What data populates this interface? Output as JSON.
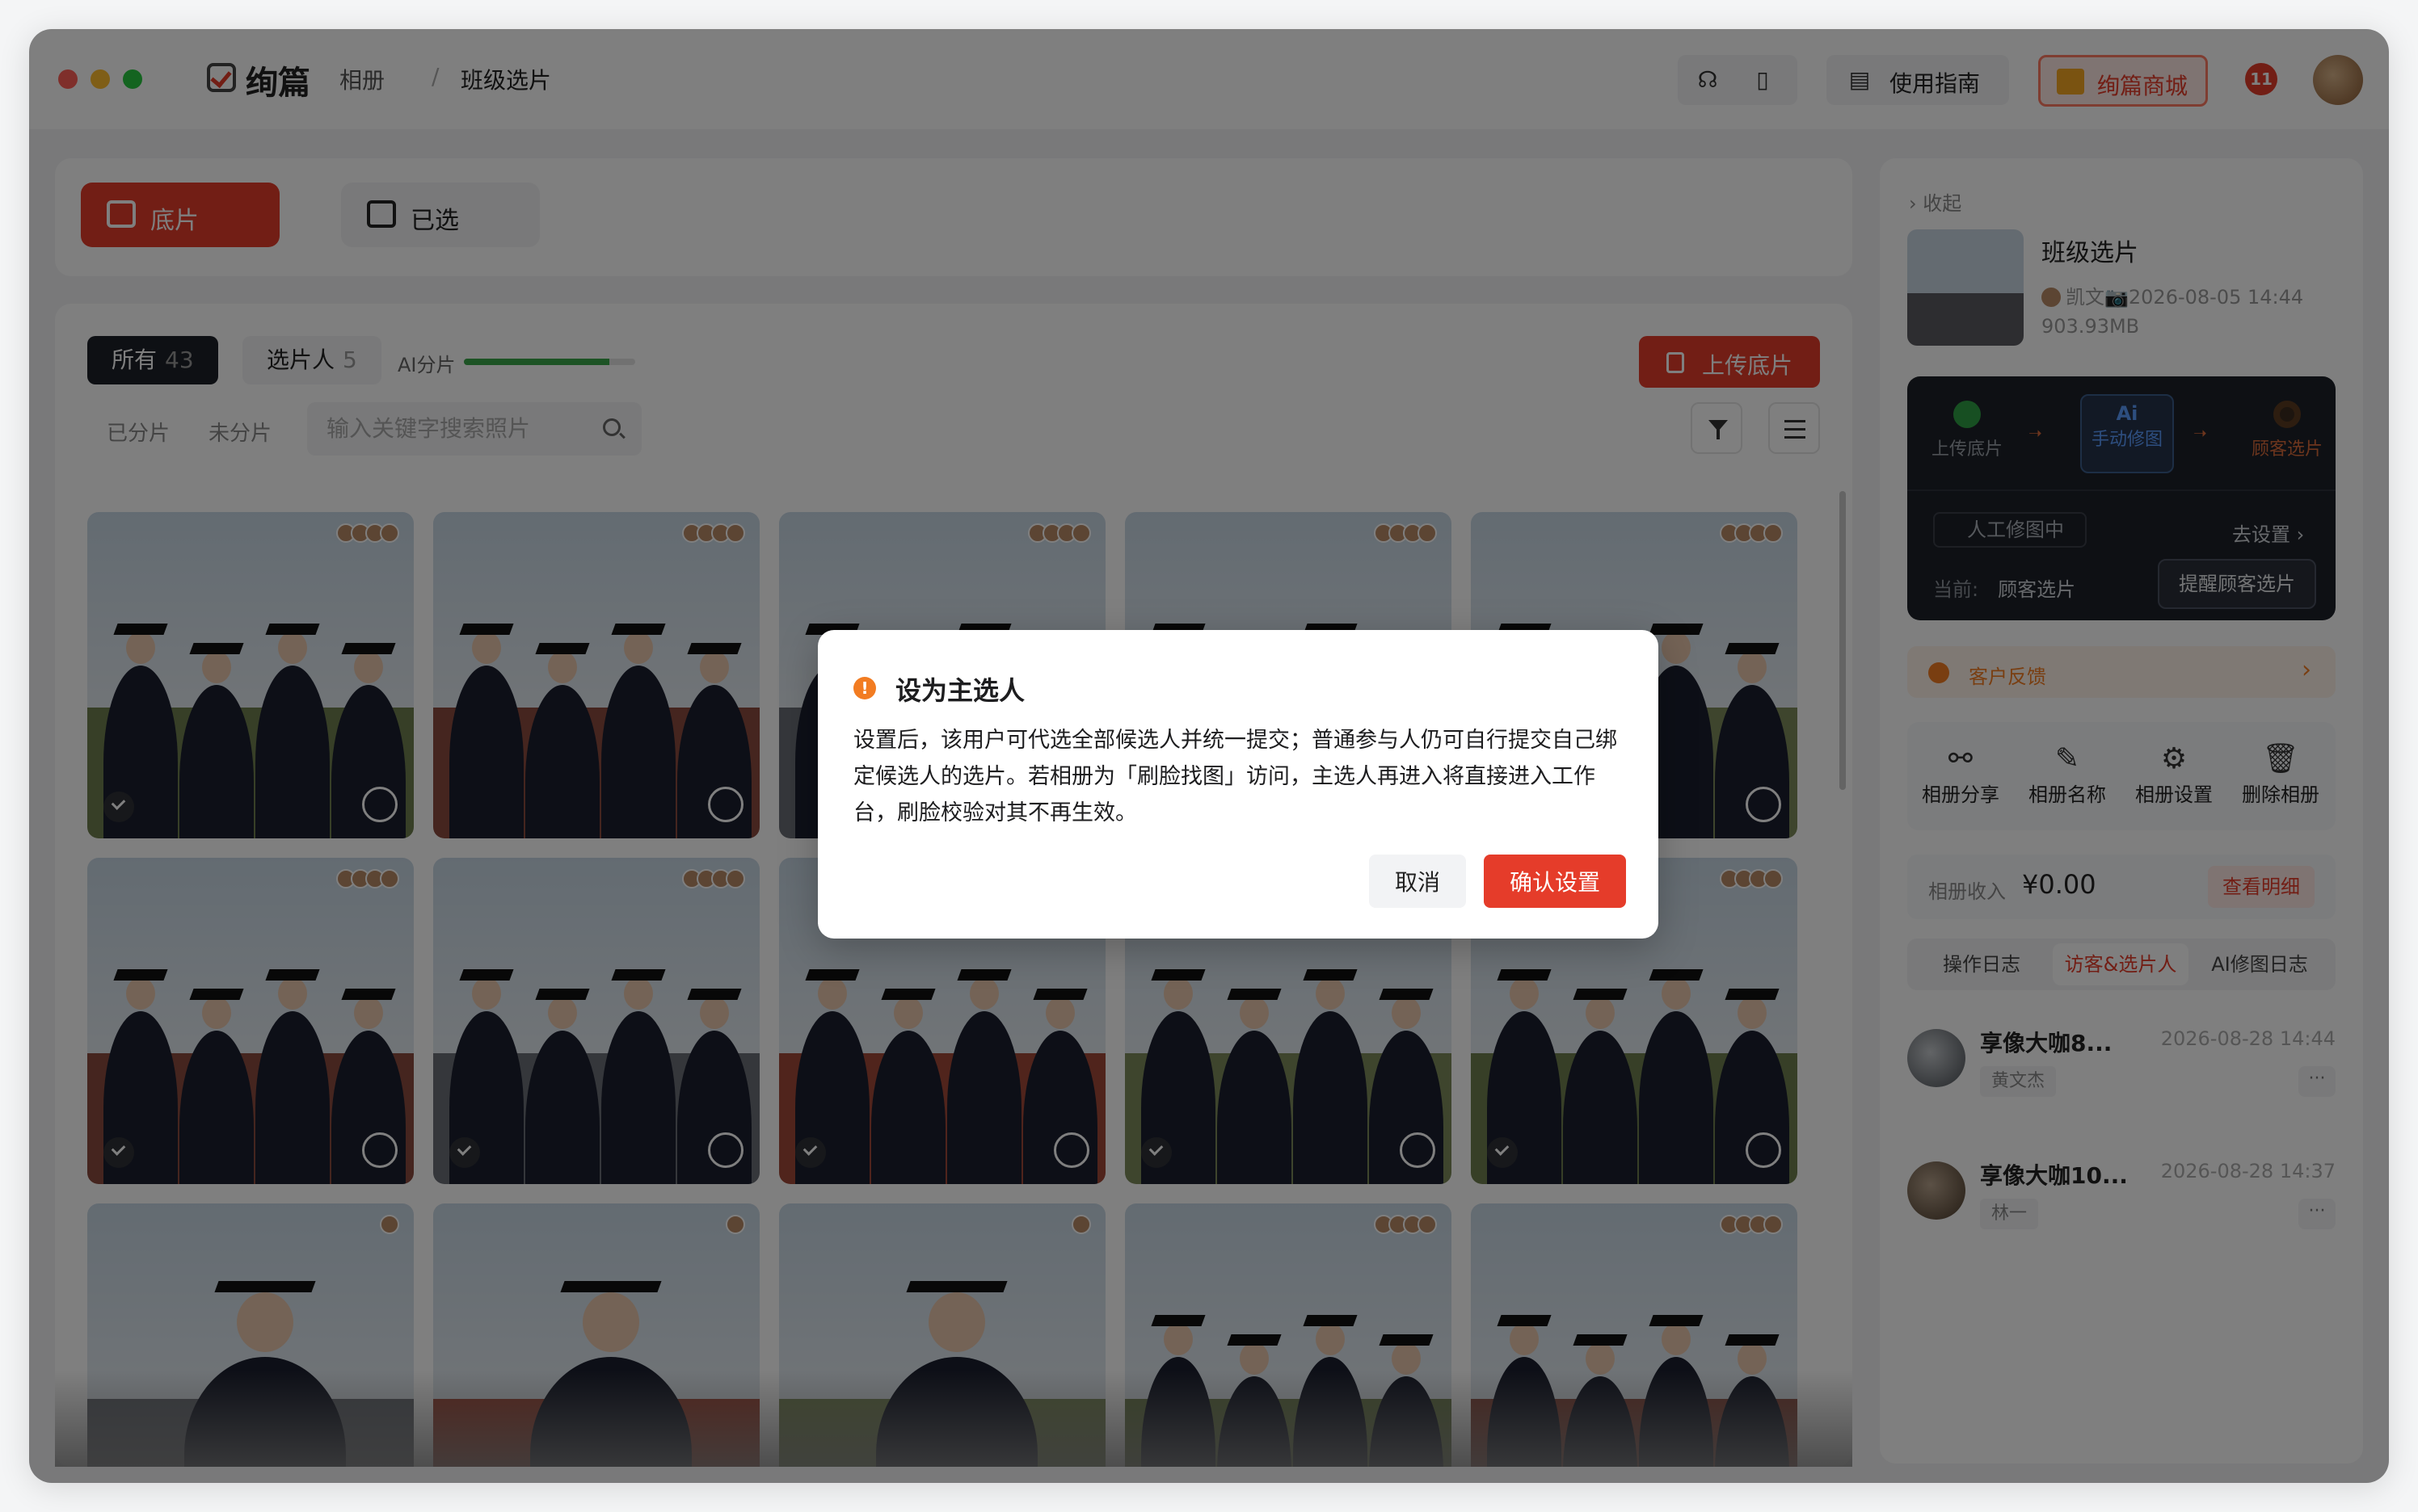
{
  "app": {
    "name": "绚篇",
    "breadcrumb": [
      "相册",
      "班级选片"
    ]
  },
  "toolbar": {
    "guide_label": "使用指南",
    "mall_label": "绚篇商城",
    "notif_badge": "11"
  },
  "main_tabs": [
    {
      "label": "底片",
      "icon": "image-icon",
      "active": true
    },
    {
      "label": "已选",
      "icon": "selected-image-icon",
      "active": false
    }
  ],
  "gallery": {
    "chips": [
      {
        "label": "所有",
        "count": "43"
      },
      {
        "label": "选片人",
        "count": "5"
      }
    ],
    "ai_label": "AI分片",
    "ai_progress": 0.85,
    "upload_label": "上传底片",
    "sub_tabs": [
      "已分片",
      "未分片"
    ],
    "search_placeholder": "输入关键字搜索照片"
  },
  "right_panel": {
    "collapse_label": "收起",
    "album_title": "班级选片",
    "album_owner": "凯文📷",
    "album_date": "2026-08-05 14:44",
    "album_size": "903.93MB",
    "flow_steps": [
      "上传底片",
      "手动修图",
      "顾客选片"
    ],
    "flow_ai_badge": "Ai",
    "flow_status": "人工修图中",
    "flow_set_label": "去设置",
    "flow_current_label": "当前:",
    "flow_current_value": "顾客选片",
    "remind_button": "提醒顾客选片",
    "feedback_label": "客户反馈",
    "actions": [
      "相册分享",
      "相册名称",
      "相册设置",
      "删除相册"
    ],
    "income_label": "相册收入",
    "income_value": "¥0.00",
    "income_detail": "查看明细",
    "log_tabs": [
      "操作日志",
      "访客&选片人",
      "AI修图日志"
    ],
    "visitors": [
      {
        "name": "享像大咖8...",
        "time": "2026-08-28 14:44",
        "tag": "黄文杰"
      },
      {
        "name": "享像大咖10...",
        "time": "2026-08-28 14:37",
        "tag": "林一"
      }
    ]
  },
  "dialog": {
    "title": "设为主选人",
    "body": "设置后，该用户可代选全部候选人并统一提交；普通参与人仍可自行提交自己绑定候选人的选片。若相册为「刷脸找图」访问，主选人再进入将直接进入工作台，刷脸校验对其不再生效。",
    "cancel_label": "取消",
    "confirm_label": "确认设置"
  },
  "colors": {
    "accent": "#e53c2a",
    "warning": "#f27c22",
    "dark": "#1d2129"
  }
}
